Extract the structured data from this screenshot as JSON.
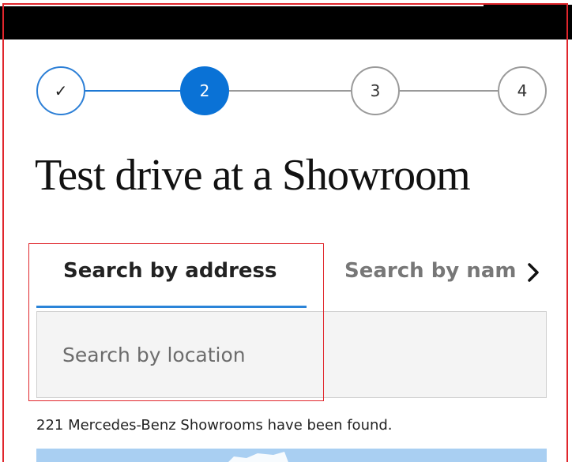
{
  "stepper": {
    "steps": [
      {
        "label": "✓",
        "state": "completed"
      },
      {
        "label": "2",
        "state": "active"
      },
      {
        "label": "3",
        "state": "upcoming"
      },
      {
        "label": "4",
        "state": "upcoming"
      }
    ]
  },
  "page_title": "Test drive at a Showroom",
  "tabs": [
    {
      "label": "Search by address",
      "active": true
    },
    {
      "label": "Search by name",
      "active": false
    }
  ],
  "tab_scroll_icon": "chevron-right-icon",
  "search": {
    "value": "",
    "placeholder": "Search by location"
  },
  "results_text": "221 Mercedes-Benz Showrooms have been found.",
  "colors": {
    "accent": "#0a72d6",
    "inactive_step": "#9a9a9a",
    "map_water": "#a9cff2"
  }
}
